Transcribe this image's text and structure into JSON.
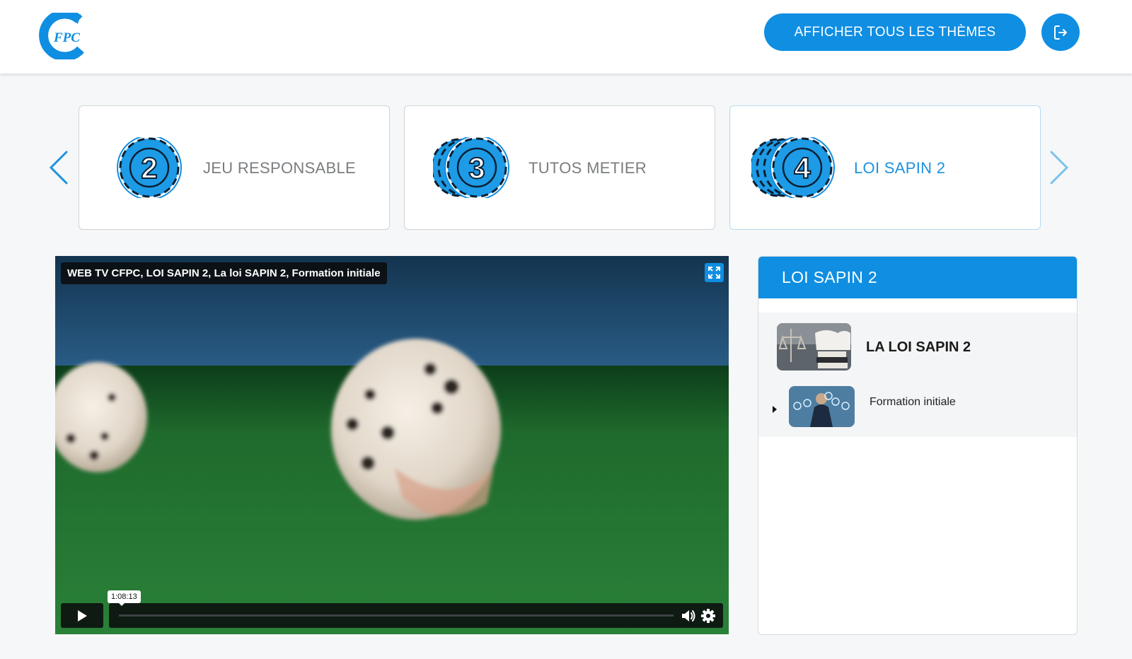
{
  "header": {
    "logo_text": "FPC",
    "themes_button_label": "AFFICHER TOUS LES THÈMES",
    "logout_icon": "logout-icon"
  },
  "carousel": {
    "prev_icon": "chevron-left-icon",
    "next_icon": "chevron-right-icon",
    "cards": [
      {
        "number": "2",
        "label": "JEU RESPONSABLE",
        "active": false
      },
      {
        "number": "3",
        "label": "TUTOS METIER",
        "active": false
      },
      {
        "number": "4",
        "label": "LOI SAPIN 2",
        "active": true
      }
    ]
  },
  "video": {
    "title": "WEB TV CFPC, LOI SAPIN 2, La loi SAPIN 2, Formation initiale",
    "time_tooltip": "1:08:13",
    "progress": 0,
    "icons": [
      "fullscreen-icon",
      "play-icon",
      "volume-icon",
      "settings-icon"
    ]
  },
  "playlist": {
    "header": "LOI SAPIN 2",
    "group_title": "LA LOI SAPIN 2",
    "items": [
      {
        "title": "Formation initiale"
      }
    ]
  },
  "colors": {
    "accent": "#0f8ee2",
    "active_text": "#1d92df",
    "muted_text": "#7a7d80"
  }
}
